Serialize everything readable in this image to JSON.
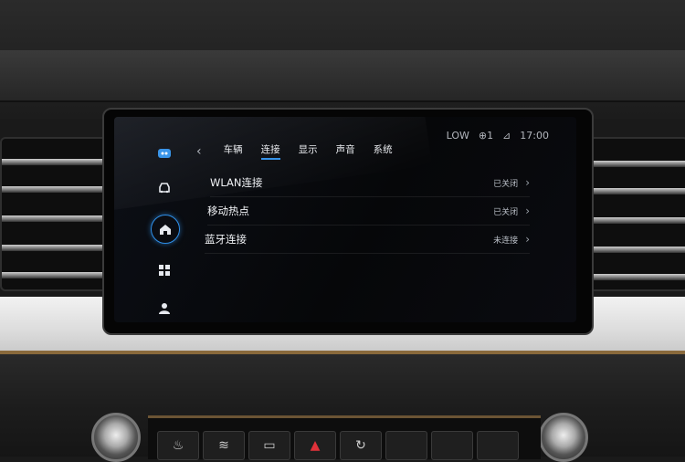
{
  "status_bar": {
    "items": [
      "LOW",
      "⊕1",
      "⊿",
      "17:00"
    ]
  },
  "sidebar": {
    "items": [
      {
        "icon": "media-icon"
      },
      {
        "icon": "car-icon"
      },
      {
        "icon": "home-icon"
      },
      {
        "icon": "apps-icon"
      },
      {
        "icon": "user-icon"
      }
    ]
  },
  "tabs": {
    "back_glyph": "‹",
    "items": [
      {
        "label": "车辆"
      },
      {
        "label": "连接"
      },
      {
        "label": "显示"
      },
      {
        "label": "声音"
      },
      {
        "label": "系统"
      }
    ],
    "active": "连接"
  },
  "settings": {
    "rows": [
      {
        "label": "WLAN连接",
        "value": "已关闭"
      },
      {
        "label": "移动热点",
        "value": "已关闭"
      },
      {
        "label": "蓝牙连接",
        "value": "未连接"
      }
    ]
  },
  "colors": {
    "accent": "#2f8fe8"
  }
}
